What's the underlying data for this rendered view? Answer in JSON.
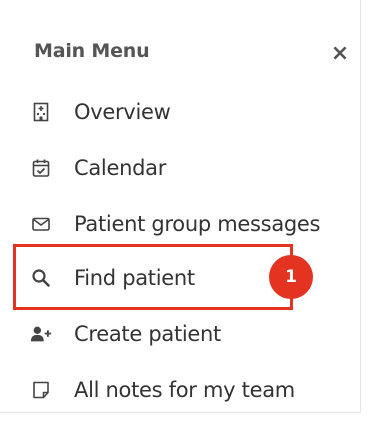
{
  "menu": {
    "title": "Main Menu",
    "close_glyph": "×",
    "items": [
      {
        "label": "Overview",
        "icon": "hospital-icon"
      },
      {
        "label": "Calendar",
        "icon": "calendar-check-icon"
      },
      {
        "label": "Patient group messages",
        "icon": "envelope-icon"
      },
      {
        "label": "Find patient",
        "icon": "search-icon"
      },
      {
        "label": "Create patient",
        "icon": "user-plus-icon"
      },
      {
        "label": "All notes for my team",
        "icon": "note-icon"
      }
    ]
  },
  "annotation": {
    "badge": "1",
    "color": "#e53322"
  }
}
